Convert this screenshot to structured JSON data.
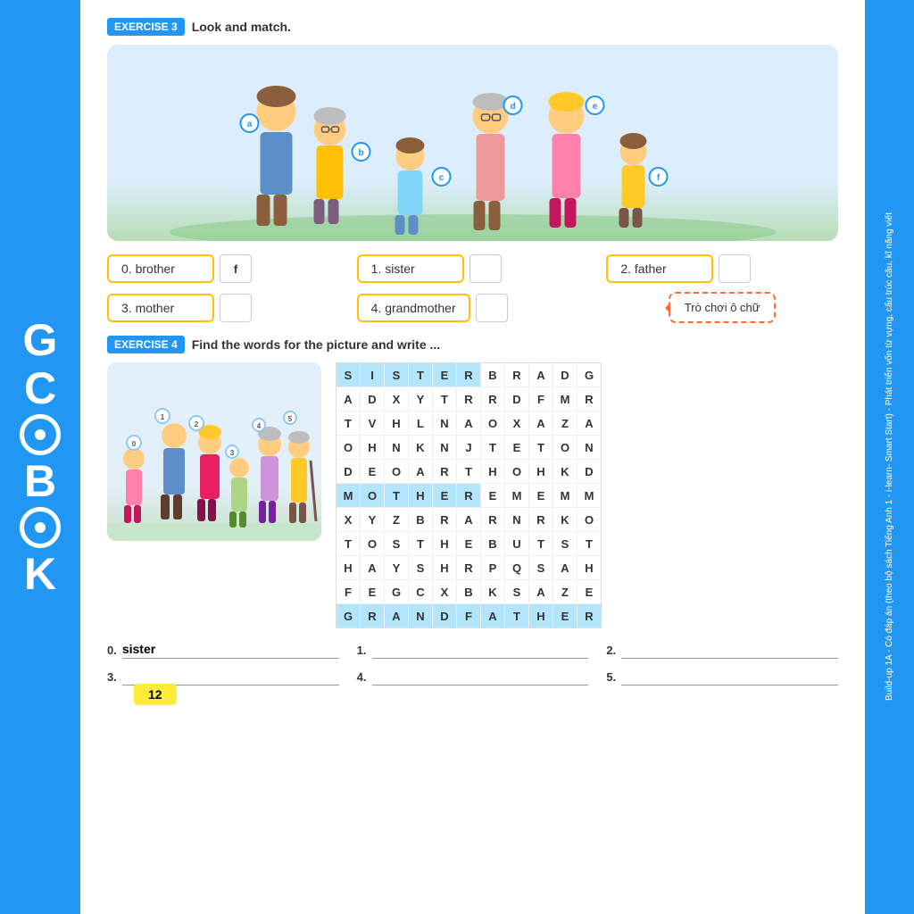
{
  "sidebar": {
    "logo_letters": [
      "G",
      "C",
      "B",
      "O",
      "K"
    ]
  },
  "exercise3": {
    "label": "EXERCISE 3",
    "title": "Look and match.",
    "items": [
      {
        "number": "0.",
        "word": "brother",
        "answer": "f",
        "answered": true
      },
      {
        "number": "1.",
        "word": "sister",
        "answer": "",
        "answered": false
      },
      {
        "number": "2.",
        "word": "father",
        "answer": "",
        "answered": false
      },
      {
        "number": "3.",
        "word": "mother",
        "answer": "",
        "answered": false
      },
      {
        "number": "4.",
        "word": "grandmother",
        "answer": "",
        "answered": false
      }
    ],
    "figure_labels": [
      "a",
      "b",
      "c",
      "d",
      "e",
      "f"
    ],
    "tooltip": "Trò chơi ô chữ"
  },
  "exercise4": {
    "label": "EXERCISE 4",
    "title": "Find the words for the picture and write ...",
    "word_search": [
      [
        "S",
        "I",
        "S",
        "T",
        "E",
        "R",
        "B",
        "R",
        "A",
        "D",
        "G"
      ],
      [
        "A",
        "D",
        "X",
        "Y",
        "T",
        "R",
        "R",
        "D",
        "F",
        "M",
        "R"
      ],
      [
        "T",
        "V",
        "H",
        "L",
        "N",
        "A",
        "O",
        "X",
        "A",
        "Z",
        "A"
      ],
      [
        "O",
        "H",
        "N",
        "K",
        "N",
        "J",
        "T",
        "E",
        "T",
        "O",
        "N"
      ],
      [
        "D",
        "E",
        "O",
        "A",
        "R",
        "T",
        "H",
        "O",
        "H",
        "K",
        "D"
      ],
      [
        "M",
        "O",
        "T",
        "H",
        "E",
        "R",
        "E",
        "M",
        "E",
        "M",
        "M"
      ],
      [
        "X",
        "Y",
        "Z",
        "B",
        "R",
        "A",
        "R",
        "N",
        "R",
        "K",
        "O"
      ],
      [
        "T",
        "O",
        "S",
        "T",
        "H",
        "E",
        "B",
        "U",
        "T",
        "S",
        "T"
      ],
      [
        "H",
        "A",
        "Y",
        "S",
        "H",
        "R",
        "P",
        "Q",
        "S",
        "A",
        "H"
      ],
      [
        "F",
        "E",
        "G",
        "C",
        "X",
        "B",
        "K",
        "S",
        "A",
        "Z",
        "E"
      ],
      [
        "G",
        "R",
        "A",
        "N",
        "D",
        "F",
        "A",
        "T",
        "H",
        "E",
        "R"
      ]
    ],
    "answers": [
      {
        "number": "0.",
        "value": "sister"
      },
      {
        "number": "1.",
        "value": ""
      },
      {
        "number": "2.",
        "value": ""
      },
      {
        "number": "3.",
        "value": ""
      },
      {
        "number": "4.",
        "value": ""
      },
      {
        "number": "5.",
        "value": ""
      }
    ]
  },
  "page_number": "12",
  "right_sidebar_text": "Build-up 1A - Có đáp án (theo bộ sách Tiếng Anh 1 - i-learn- Smart Start) - Phát triển vốn từ vựng, cấu trúc câu, kĩ năng viết"
}
